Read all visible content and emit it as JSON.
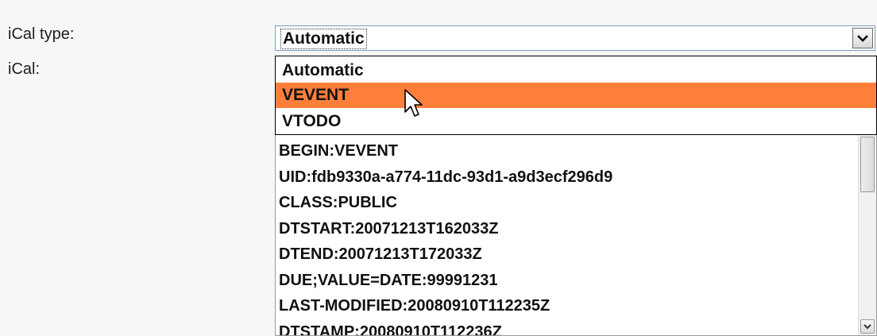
{
  "form": {
    "ical_type_label": "iCal type:",
    "ical_label": "iCal:"
  },
  "ical_type_select": {
    "selected_value": "Automatic",
    "options": [
      "Automatic",
      "VEVENT",
      "VTODO"
    ],
    "highlighted_option": "VEVENT",
    "highlight_color": "#ff7f3a",
    "arrow_icon": "chevron-down-icon"
  },
  "ical_textarea": {
    "lines": [
      "BEGIN:VEVENT",
      "UID:fdb9330a-a774-11dc-93d1-a9d3ecf296d9",
      "CLASS:PUBLIC",
      "DTSTART:20071213T162033Z",
      "DTEND:20071213T172033Z",
      "DUE;VALUE=DATE:99991231",
      "LAST-MODIFIED:20080910T112235Z",
      "DTSTAMP:20080910T112236Z"
    ]
  },
  "cursor": {
    "icon": "mouse-pointer-icon"
  }
}
